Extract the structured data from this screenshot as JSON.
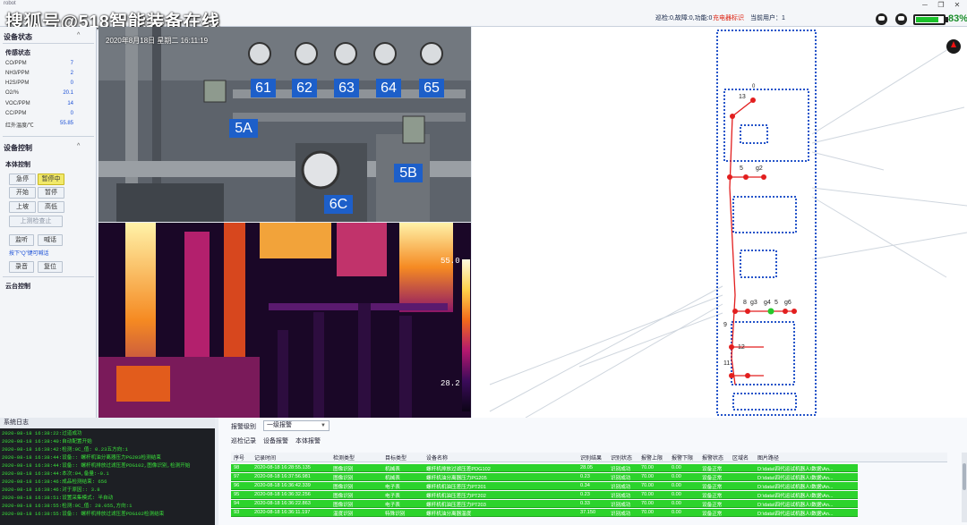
{
  "app": {
    "name": "robot",
    "watermark": "搜狐号@518智能装备在线"
  },
  "status_bar": {
    "cruise_info": "巡检:0,故障:0,功能:0",
    "charging": "充电器标识",
    "current_user": "当前用户：1",
    "battery_percent": "83%",
    "battery_level": 0.83
  },
  "window_controls": [
    "─",
    "❐",
    "✕"
  ],
  "device_status": {
    "title": "设备状态",
    "sensor_section": "传感状态",
    "sensors": [
      {
        "label": "CO/PPM",
        "value": "7"
      },
      {
        "label": "NH3/PPM",
        "value": "2"
      },
      {
        "label": "H2S/PPM",
        "value": "0"
      },
      {
        "label": "O2/%",
        "value": "20.1"
      },
      {
        "label": "VOC/PPM",
        "value": "14"
      },
      {
        "label": "CC/PPM",
        "value": "0"
      },
      {
        "label": "红外温度/℃",
        "value": "55.85"
      }
    ]
  },
  "device_control": {
    "title": "设备控制",
    "body_section": "本体控制",
    "buttons": {
      "emergency_stop": "急停",
      "pausing": "暂停中",
      "start": "开始",
      "pause": "暂停",
      "up": "上坡",
      "high": "高低",
      "station": "上测检查止",
      "monitor": "监听",
      "shout": "喊话",
      "record": "录音",
      "reset": "复位"
    },
    "hint": "按下“Q”键可喊话",
    "ptz_section": "云台控制"
  },
  "camera": {
    "timestamp": "2020年8月18日 星期二 16:11:19",
    "labels": [
      "61",
      "62",
      "63",
      "64",
      "65",
      "5A",
      "5B",
      "6C"
    ]
  },
  "thermal": {
    "max_temp": "55.0",
    "min_temp": "28.2"
  },
  "map": {
    "nodes": [
      "0",
      "13",
      "5",
      "g2",
      "8",
      "g3",
      "g4",
      "5",
      "g6",
      "9",
      "12",
      "11"
    ]
  },
  "system_log": {
    "title": "系统日志",
    "lines": [
      "2020-08-18 16:38:22:过道成功",
      "2020-08-18 16:38:40:自动配置开始",
      "2020-08-18 16:38:42:检测:0C_值: 0.23五方向:1",
      "2020-08-18 16:38:44:设备:: 螺杆机油分离器压力PG203检测结束",
      "2020-08-18 16:38:44:设备:: 螺杆机排放过滤压差PDG102,图像识别,检测开始",
      "2020-08-18 16:38:44:本次:94,备量:-0.1",
      "2020-08-18 16:38:46:成品检测结束: 656",
      "2020-08-18 16:38:46:对于原因:: 3.8",
      "2020-08-18 16:38:51:设置采集模式: 半自动",
      "2020-08-18 16:38:55:检测:0C_值: 28.055,方向:1",
      "2020-08-18 16:38:55:设备:: 螺杆机排放过滤压差PDG102检测结束"
    ]
  },
  "alarm": {
    "level_label": "报警级别",
    "level_value": "一级报警",
    "tabs": [
      "巡检记录",
      "设备报警",
      "本体报警"
    ],
    "columns": [
      "序号",
      "记录时间",
      "检测类型",
      "目标类型",
      "设备名称",
      "识别结果",
      "识别状态",
      "报警上限",
      "报警下限",
      "报警状态",
      "区域名",
      "图片路径"
    ],
    "rows": [
      [
        "98",
        "2020-08-18 16:28:55.135",
        "图像识别",
        "机械表",
        "螺杆机排放过滤压差PDG102",
        "28.05",
        "识别成功",
        "70.00",
        "0.00",
        "设备正常",
        "",
        "D:\\data\\四代运试机器人\\数据\\An..."
      ],
      [
        "97",
        "2020-08-18 16:37:56.981",
        "图像识别",
        "机械表",
        "螺杆机油分离器压力PG205",
        "0.23",
        "识别成功",
        "70.00",
        "0.00",
        "设备正常",
        "",
        "D:\\data\\四代运试机器人\\数据\\An..."
      ],
      [
        "96",
        "2020-08-18 16:36:42.339",
        "图像识别",
        "电子表",
        "螺杆机机油压差压力PT201",
        "0.34",
        "识别成功",
        "70.00",
        "0.00",
        "设备正常",
        "",
        "D:\\data\\四代运试机器人\\数据\\An..."
      ],
      [
        "95",
        "2020-08-18 16:36:32.256",
        "图像识别",
        "电子表",
        "螺杆机机油压差压力PT202",
        "0.23",
        "识别成功",
        "70.00",
        "0.00",
        "设备正常",
        "",
        "D:\\data\\四代运试机器人\\数据\\An..."
      ],
      [
        "94",
        "2020-08-18 16:36:22.863",
        "图像识别",
        "电子表",
        "螺杆机机油压差压力PT203",
        "0.33",
        "识别成功",
        "70.00",
        "0.00",
        "设备正常",
        "",
        "D:\\data\\四代运试机器人\\数据\\An..."
      ],
      [
        "93",
        "2020-08-18 16:36:11.197",
        "温度识别",
        "特殊识别",
        "螺杆机油分离器温度",
        "37.150",
        "识别成功",
        "70.00",
        "0.00",
        "设备正常",
        "",
        "D:\\data\\四代运试机器人\\数据\\An..."
      ]
    ]
  },
  "colors": {
    "accent": "#1d5fc9",
    "row_green": "#2cd32c",
    "log_green": "#39e23a",
    "alert_red": "#d21111",
    "route_red": "#e21e1e"
  }
}
